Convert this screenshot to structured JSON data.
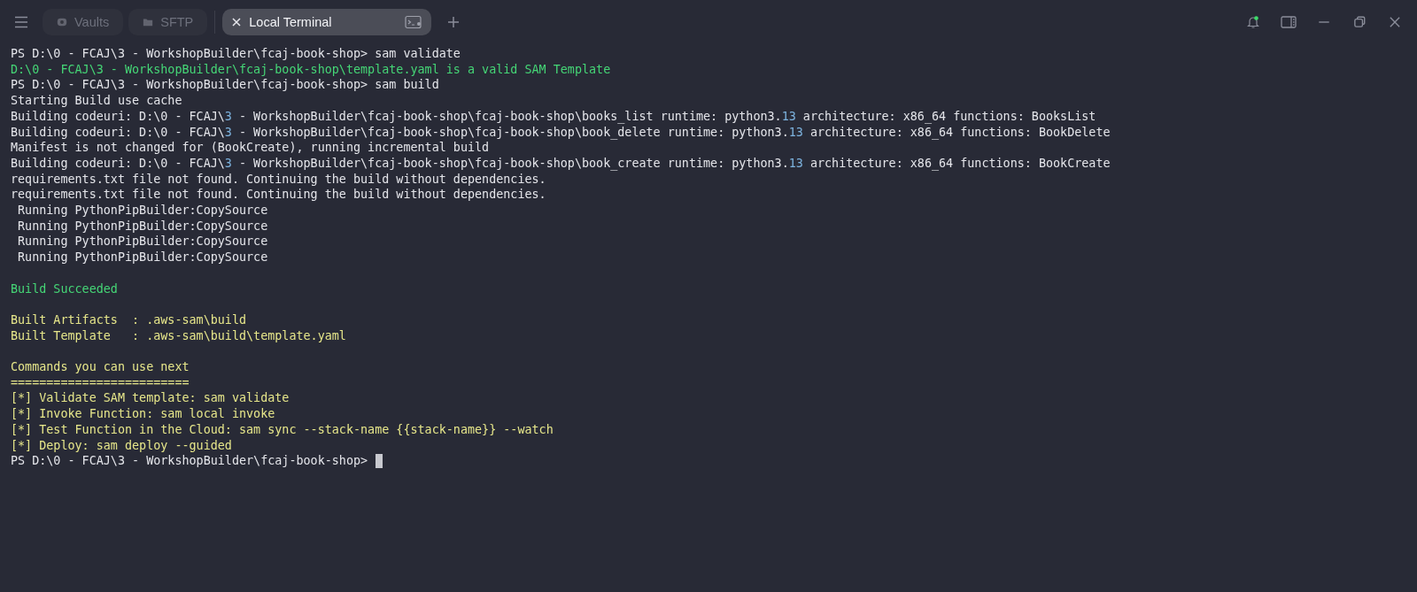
{
  "tabs": [
    {
      "label": "Vaults",
      "kind": "vaults",
      "selected": false
    },
    {
      "label": "SFTP",
      "kind": "folder",
      "selected": false
    },
    {
      "label": "Local Terminal",
      "kind": "terminal",
      "selected": true
    }
  ],
  "notifications": {
    "unread": true
  },
  "terminal": {
    "lines": [
      {
        "kind": "plain",
        "segments": [
          {
            "text": "PS D:\\0 - FCAJ\\3 - WorkshopBuilder\\fcaj-book-shop> sam validate",
            "kind": "text"
          }
        ]
      },
      {
        "kind": "success",
        "segments": [
          {
            "text": "D:\\0 - FCAJ\\3 - WorkshopBuilder\\fcaj-book-shop\\template.yaml is a valid SAM Template",
            "kind": "text"
          }
        ]
      },
      {
        "kind": "plain",
        "segments": [
          {
            "text": "PS D:\\0 - FCAJ\\3 - WorkshopBuilder\\fcaj-book-shop> sam build",
            "kind": "text"
          }
        ]
      },
      {
        "kind": "plain",
        "segments": [
          {
            "text": "Starting Build use cache",
            "kind": "text"
          }
        ]
      },
      {
        "kind": "plain",
        "segments": [
          {
            "text": "Building codeuri: D:\\0 - FCAJ\\",
            "kind": "text"
          },
          {
            "text": "3",
            "kind": "number"
          },
          {
            "text": " - WorkshopBuilder\\fcaj-book-shop\\fcaj-book-shop\\books_list runtime: python3.",
            "kind": "text"
          },
          {
            "text": "13",
            "kind": "number"
          },
          {
            "text": " architecture: x86_64 functions: BooksList",
            "kind": "text"
          }
        ]
      },
      {
        "kind": "plain",
        "segments": [
          {
            "text": "Building codeuri: D:\\0 - FCAJ\\",
            "kind": "text"
          },
          {
            "text": "3",
            "kind": "number"
          },
          {
            "text": " - WorkshopBuilder\\fcaj-book-shop\\fcaj-book-shop\\book_delete runtime: python3.",
            "kind": "text"
          },
          {
            "text": "13",
            "kind": "number"
          },
          {
            "text": " architecture: x86_64 functions: BookDelete",
            "kind": "text"
          }
        ]
      },
      {
        "kind": "plain",
        "segments": [
          {
            "text": "Manifest is not changed for (BookCreate), running incremental build",
            "kind": "text"
          }
        ]
      },
      {
        "kind": "plain",
        "segments": [
          {
            "text": "Building codeuri: D:\\0 - FCAJ\\",
            "kind": "text"
          },
          {
            "text": "3",
            "kind": "number"
          },
          {
            "text": " - WorkshopBuilder\\fcaj-book-shop\\fcaj-book-shop\\book_create runtime: python3.",
            "kind": "text"
          },
          {
            "text": "13",
            "kind": "number"
          },
          {
            "text": " architecture: x86_64 functions: BookCreate",
            "kind": "text"
          }
        ]
      },
      {
        "kind": "plain",
        "segments": [
          {
            "text": "requirements.txt file not found. Continuing the build without dependencies.",
            "kind": "text"
          }
        ]
      },
      {
        "kind": "plain",
        "segments": [
          {
            "text": "requirements.txt file not found. Continuing the build without dependencies.",
            "kind": "text"
          }
        ]
      },
      {
        "kind": "plain",
        "segments": [
          {
            "text": " Running PythonPipBuilder:CopySource",
            "kind": "text"
          }
        ]
      },
      {
        "kind": "plain",
        "segments": [
          {
            "text": " Running PythonPipBuilder:CopySource",
            "kind": "text"
          }
        ]
      },
      {
        "kind": "plain",
        "segments": [
          {
            "text": " Running PythonPipBuilder:CopySource",
            "kind": "text"
          }
        ]
      },
      {
        "kind": "plain",
        "segments": [
          {
            "text": " Running PythonPipBuilder:CopySource",
            "kind": "text"
          }
        ]
      },
      {
        "kind": "blank"
      },
      {
        "kind": "success",
        "segments": [
          {
            "text": "Build Succeeded",
            "kind": "text"
          }
        ]
      },
      {
        "kind": "blank"
      },
      {
        "kind": "warning",
        "segments": [
          {
            "text": "Built Artifacts  : .aws-sam\\build",
            "kind": "text"
          }
        ]
      },
      {
        "kind": "warning",
        "segments": [
          {
            "text": "Built Template   : .aws-sam\\build\\template.yaml",
            "kind": "text"
          }
        ]
      },
      {
        "kind": "blank"
      },
      {
        "kind": "warning",
        "segments": [
          {
            "text": "Commands you can use next",
            "kind": "text"
          }
        ]
      },
      {
        "kind": "warning",
        "segments": [
          {
            "text": "=========================",
            "kind": "text"
          }
        ]
      },
      {
        "kind": "warning",
        "segments": [
          {
            "text": "[*] Validate SAM template: sam validate",
            "kind": "text"
          }
        ]
      },
      {
        "kind": "warning",
        "segments": [
          {
            "text": "[*] Invoke Function: sam local invoke",
            "kind": "text"
          }
        ]
      },
      {
        "kind": "warning",
        "segments": [
          {
            "text": "[*] Test Function in the Cloud: sam sync --stack-name {{stack-name}} --watch",
            "kind": "text"
          }
        ]
      },
      {
        "kind": "warning",
        "segments": [
          {
            "text": "[*] Deploy: sam deploy --guided",
            "kind": "text"
          }
        ]
      },
      {
        "kind": "prompt",
        "segments": [
          {
            "text": "PS D:\\0 - FCAJ\\3 - WorkshopBuilder\\fcaj-book-shop>",
            "kind": "text"
          }
        ]
      }
    ]
  }
}
